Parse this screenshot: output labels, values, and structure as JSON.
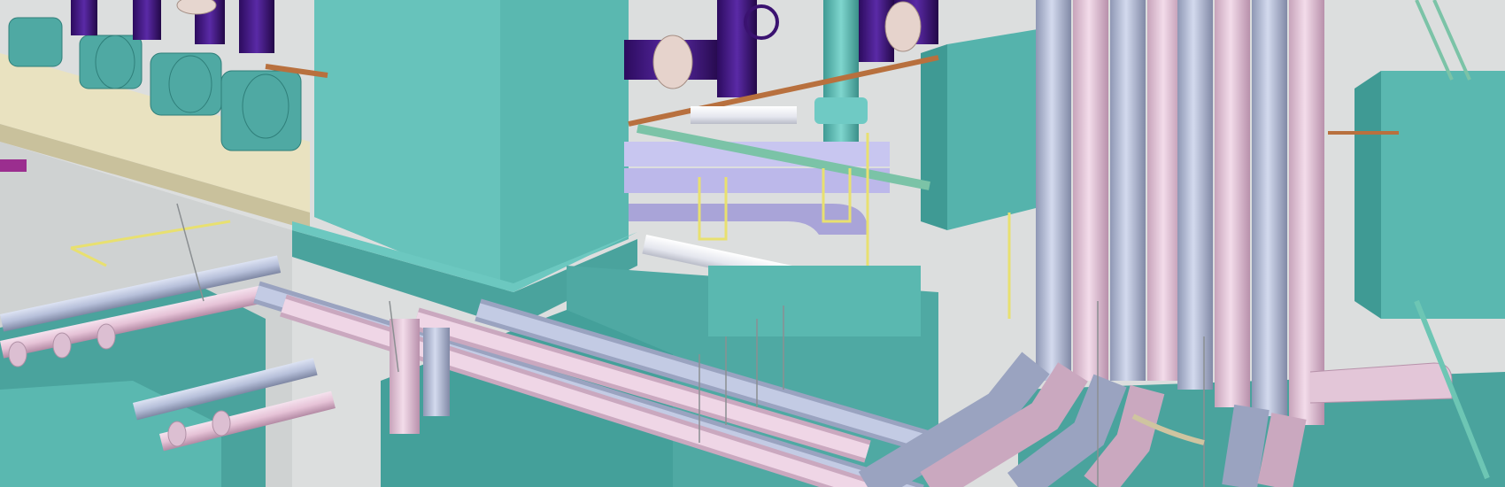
{
  "scene": {
    "colors": {
      "background": "#d9dcdc",
      "teal": "#5fbdb5",
      "teal_dark": "#3f9a94",
      "teal_shadow": "#2f7f7a",
      "pink_pipe": "#e8c8dc",
      "blue_pipe": "#b9c2dc",
      "violet_pipe": "#4a1a8a",
      "cyan_pipe": "#7fd6d6",
      "beige_beam": "#ede6c4",
      "yellow_support": "#e8e070",
      "orange_rail": "#b8703e",
      "white_pipe": "#eef0f4"
    }
  }
}
